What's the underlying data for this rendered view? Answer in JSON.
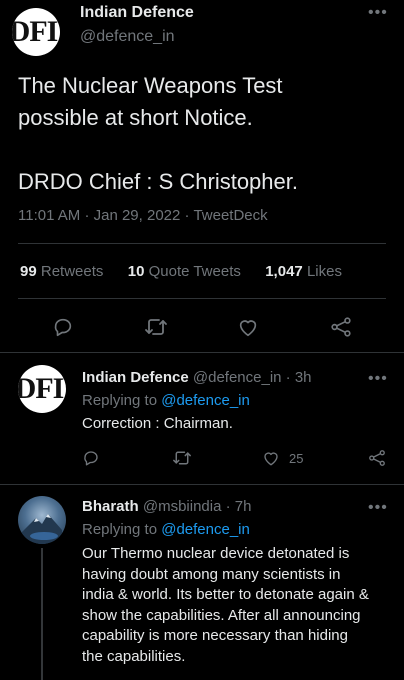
{
  "main_tweet": {
    "avatar_text": "DFI",
    "display_name": "Indian Defence",
    "handle": "@defence_in",
    "text_line1": "The Nuclear Weapons Test",
    "text_line2": "possible at short Notice.",
    "text_line3": "DRDO Chief : S Christopher.",
    "time": "11:01 AM",
    "date": "Jan 29, 2022",
    "source": "TweetDeck",
    "stats": {
      "retweets_count": "99",
      "retweets_label": "Retweets",
      "quotes_count": "10",
      "quotes_label": "Quote Tweets",
      "likes_count": "1,047",
      "likes_label": "Likes"
    }
  },
  "replies": [
    {
      "avatar_text": "DFI",
      "display_name": "Indian Defence",
      "handle": "@defence_in",
      "time": "3h",
      "replying_prefix": "Replying to",
      "replying_handle": "@defence_in",
      "text": "Correction : Chairman.",
      "like_count": "25"
    },
    {
      "display_name": "Bharath",
      "handle": "@msbiindia",
      "time": "7h",
      "replying_prefix": "Replying to",
      "replying_handle": "@defence_in",
      "text_lines": [
        "Our Thermo nuclear device detonated is",
        "having doubt among many scientists in",
        "india & world. Its better to detonate again &",
        "show the capabilities. After all announcing",
        "capability is more necessary than hiding",
        "the capabilities."
      ]
    }
  ],
  "icons": [
    "more-icon",
    "reply-icon",
    "retweet-icon",
    "like-icon",
    "share-icon"
  ],
  "colors": {
    "background": "#000000",
    "text": "#e7e9ea",
    "muted": "#71767b",
    "link": "#1d9bf0",
    "divider": "#2f3336"
  }
}
